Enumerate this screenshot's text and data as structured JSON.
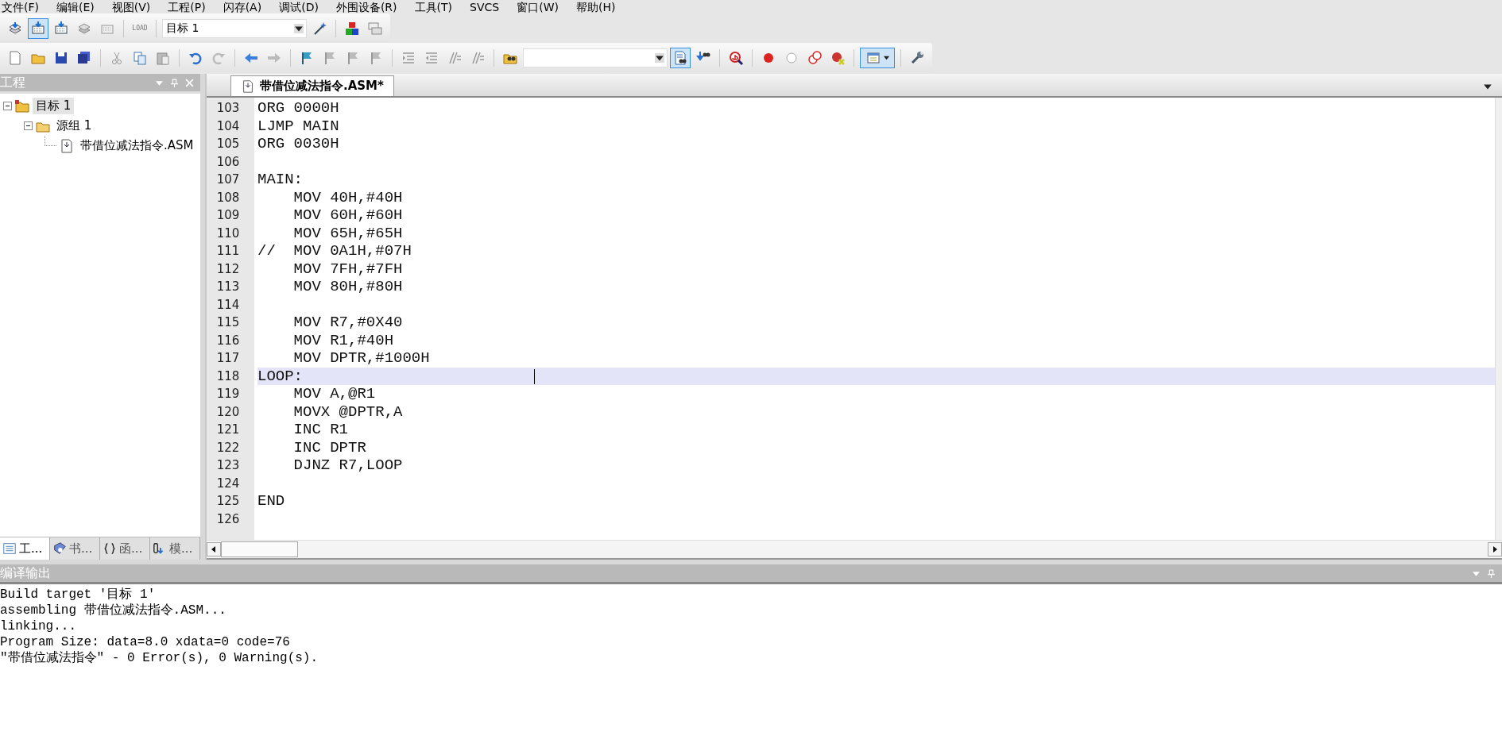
{
  "menu_bar": [
    {
      "label": "文件(F)"
    },
    {
      "label": "编辑(E)"
    },
    {
      "label": "视图(V)"
    },
    {
      "label": "工程(P)"
    },
    {
      "label": "闪存(A)"
    },
    {
      "label": "调试(D)"
    },
    {
      "label": "外围设备(R)"
    },
    {
      "label": "工具(T)"
    },
    {
      "label": "SVCS"
    },
    {
      "label": "窗口(W)"
    },
    {
      "label": "帮助(H)"
    }
  ],
  "build_toolbar": [
    {
      "kind": "stack",
      "selected": false
    },
    {
      "kind": "grid-stack",
      "selected": true
    },
    {
      "kind": "grid-stack",
      "selected": false
    },
    {
      "kind": "stack-grey",
      "selected": false
    },
    {
      "kind": "grid-grey",
      "selected": false
    },
    {
      "kind": "sep"
    },
    {
      "kind": "load",
      "label": "LOAD",
      "selected": false
    },
    {
      "kind": "sep"
    },
    {
      "kind": "dropdown",
      "value": "目标 1"
    },
    {
      "kind": "wand",
      "selected": false
    },
    {
      "kind": "sep"
    },
    {
      "kind": "blocks",
      "selected": false
    },
    {
      "kind": "windows",
      "selected": false
    }
  ],
  "file_toolbar": [
    {
      "kind": "page",
      "selected": false
    },
    {
      "kind": "folder",
      "selected": false
    },
    {
      "kind": "floppy",
      "selected": false
    },
    {
      "kind": "floppies",
      "selected": false
    },
    {
      "kind": "sep"
    },
    {
      "kind": "scissors",
      "selected": false
    },
    {
      "kind": "copy",
      "selected": false
    },
    {
      "kind": "clipboard",
      "selected": false
    },
    {
      "kind": "sep"
    },
    {
      "kind": "undo",
      "selected": false
    },
    {
      "kind": "redo",
      "selected": false
    },
    {
      "kind": "sep"
    },
    {
      "kind": "arrow-left",
      "selected": false
    },
    {
      "kind": "arrow-right",
      "selected": false
    },
    {
      "kind": "sep"
    },
    {
      "kind": "flag",
      "selected": false
    },
    {
      "kind": "flag-grey",
      "selected": false
    },
    {
      "kind": "flag-grey",
      "selected": false
    },
    {
      "kind": "flag-grey",
      "selected": false
    },
    {
      "kind": "sep"
    },
    {
      "kind": "indent",
      "selected": false
    },
    {
      "kind": "outdent",
      "selected": false
    },
    {
      "kind": "slashes",
      "selected": false
    },
    {
      "kind": "slashes",
      "selected": false
    },
    {
      "kind": "sep"
    },
    {
      "kind": "folder-binoculars",
      "selected": false
    },
    {
      "kind": "dropdown"
    },
    {
      "kind": "page-binoculars",
      "selected": true
    },
    {
      "kind": "binoculars",
      "selected": false
    },
    {
      "kind": "sep"
    },
    {
      "kind": "magnifier",
      "selected": false
    },
    {
      "kind": "sep"
    },
    {
      "kind": "dot-red",
      "selected": false
    },
    {
      "kind": "dot-empty",
      "selected": false
    },
    {
      "kind": "rings",
      "selected": false
    },
    {
      "kind": "dot-cross",
      "selected": false
    },
    {
      "kind": "sep"
    },
    {
      "kind": "window-menu",
      "selected": true
    },
    {
      "kind": "sep"
    },
    {
      "kind": "wrench",
      "selected": false
    }
  ],
  "project_panel": {
    "title": "工程",
    "tree": [
      {
        "label": "目标 1",
        "kind": "target",
        "expanded": true,
        "selected": true,
        "children": [
          {
            "label": "源组 1",
            "kind": "group",
            "expanded": true,
            "selected": false,
            "children": [
              {
                "label": "带借位减法指令.ASM",
                "kind": "file",
                "selected": false
              }
            ]
          }
        ]
      }
    ],
    "tabs": [
      {
        "label": "工...",
        "kind": "project",
        "selected": true
      },
      {
        "label": "书...",
        "kind": "books",
        "selected": false
      },
      {
        "label": "函...",
        "kind": "functions",
        "selected": false
      },
      {
        "label": "模...",
        "kind": "templates",
        "selected": false
      }
    ]
  },
  "editor": {
    "tab": {
      "label": "带借位减法指令.ASM*",
      "selected": true
    },
    "lines": [
      {
        "number": "103",
        "text": "ORG 0000H",
        "selected": false
      },
      {
        "number": "104",
        "text": "LJMP MAIN",
        "selected": false
      },
      {
        "number": "105",
        "text": "ORG 0030H",
        "selected": false
      },
      {
        "number": "106",
        "selected": false
      },
      {
        "number": "107",
        "text": "MAIN:",
        "selected": false
      },
      {
        "number": "108",
        "text": "    MOV 40H,#40H",
        "selected": false
      },
      {
        "number": "109",
        "text": "    MOV 60H,#60H",
        "selected": false
      },
      {
        "number": "110",
        "text": "    MOV 65H,#65H",
        "selected": false
      },
      {
        "number": "111",
        "text": "//  MOV 0A1H,#07H",
        "selected": false
      },
      {
        "number": "112",
        "text": "    MOV 7FH,#7FH",
        "selected": false
      },
      {
        "number": "113",
        "text": "    MOV 80H,#80H",
        "selected": false
      },
      {
        "number": "114",
        "selected": false
      },
      {
        "number": "115",
        "text": "    MOV R7,#0X40",
        "selected": false
      },
      {
        "number": "116",
        "text": "    MOV R1,#40H",
        "selected": false
      },
      {
        "number": "117",
        "text": "    MOV DPTR,#1000H",
        "selected": false
      },
      {
        "number": "118",
        "text": "LOOP:",
        "selected": true
      },
      {
        "number": "119",
        "text": "    MOV A,@R1",
        "selected": false
      },
      {
        "number": "120",
        "text": "    MOVX @DPTR,A",
        "selected": false
      },
      {
        "number": "121",
        "text": "    INC R1",
        "selected": false
      },
      {
        "number": "122",
        "text": "    INC DPTR",
        "selected": false
      },
      {
        "number": "123",
        "text": "    DJNZ R7,LOOP",
        "selected": false
      },
      {
        "number": "124",
        "selected": false
      },
      {
        "number": "125",
        "text": "END",
        "selected": false
      },
      {
        "number": "126",
        "selected": false
      }
    ]
  },
  "output_panel": {
    "title": "编译输出",
    "lines": [
      "Build target '目标 1'",
      "assembling 带借位减法指令.ASM...",
      "linking...",
      "Program Size: data=8.0 xdata=0 code=76",
      "\"带借位减法指令\" - 0 Error(s), 0 Warning(s)."
    ]
  }
}
